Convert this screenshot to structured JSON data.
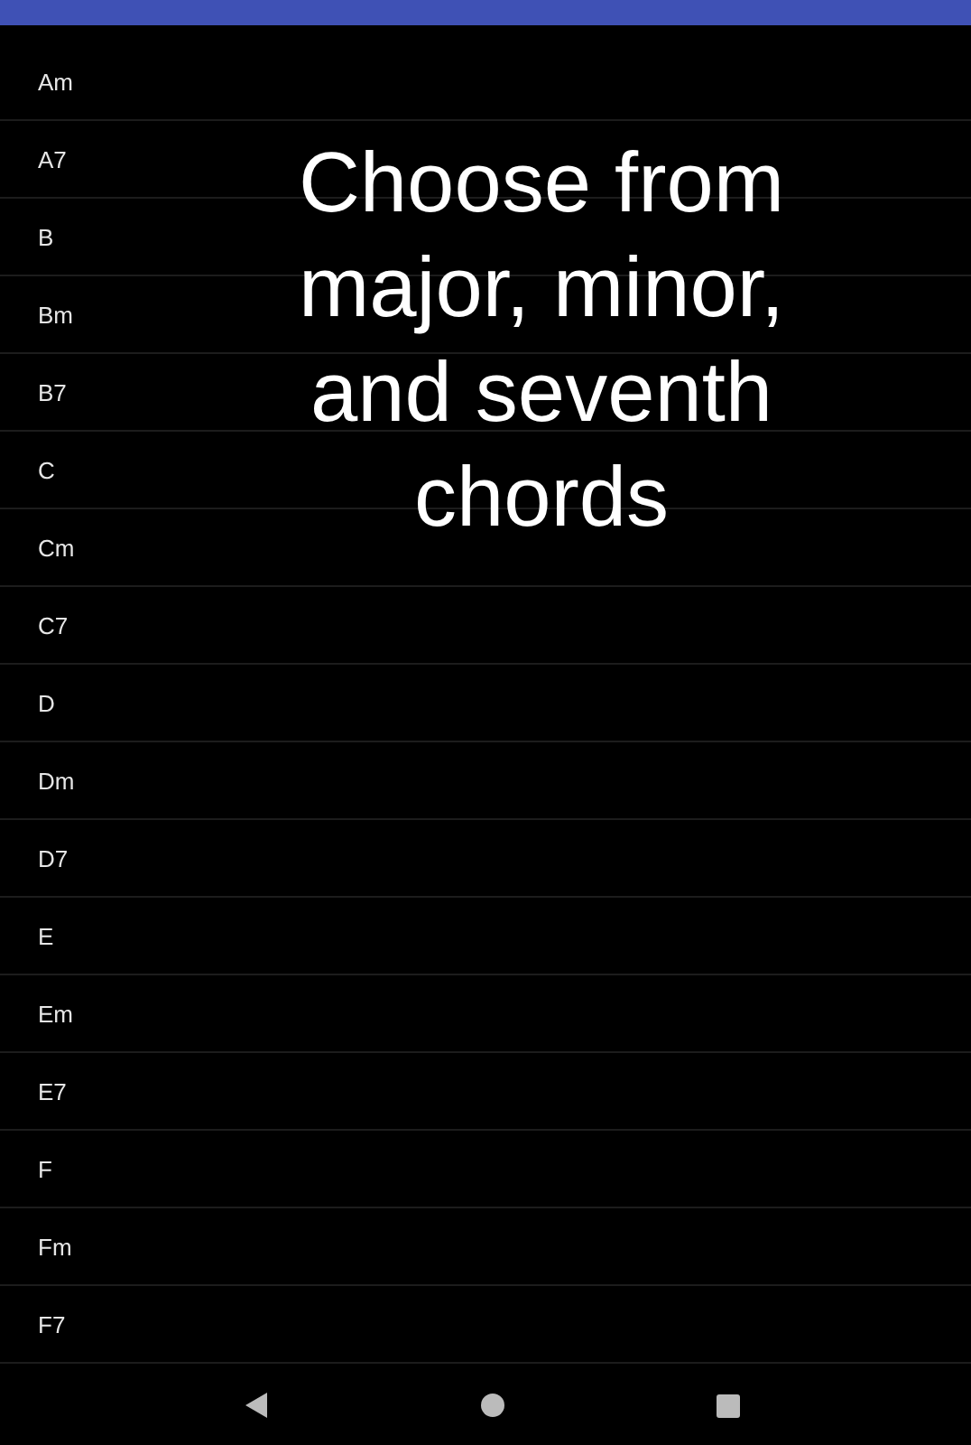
{
  "chords": [
    {
      "label": "Am"
    },
    {
      "label": "A7"
    },
    {
      "label": "B"
    },
    {
      "label": "Bm"
    },
    {
      "label": "B7"
    },
    {
      "label": "C"
    },
    {
      "label": "Cm"
    },
    {
      "label": "C7"
    },
    {
      "label": "D"
    },
    {
      "label": "Dm"
    },
    {
      "label": "D7"
    },
    {
      "label": "E"
    },
    {
      "label": "Em"
    },
    {
      "label": "E7"
    },
    {
      "label": "F"
    },
    {
      "label": "Fm"
    },
    {
      "label": "F7"
    }
  ],
  "heading": "Choose from major, minor, and seventh chords"
}
